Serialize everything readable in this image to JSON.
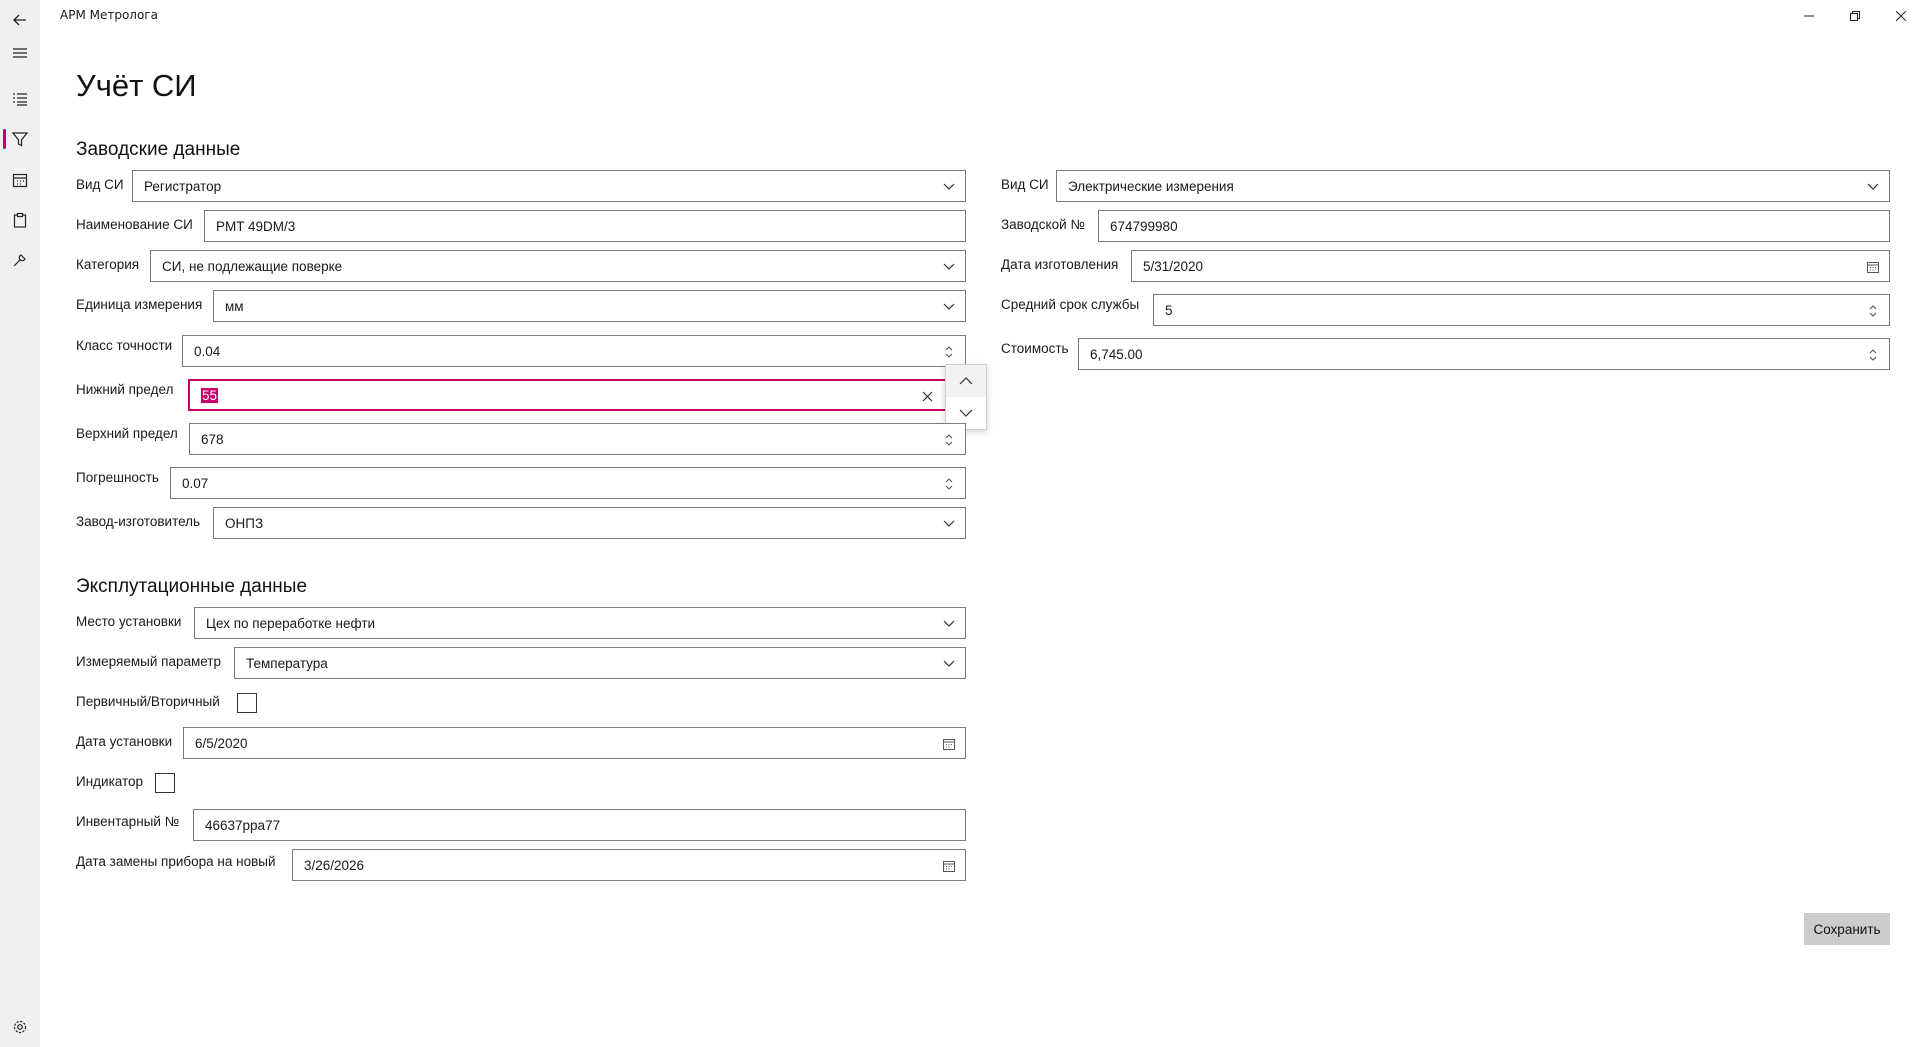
{
  "app": {
    "title": "АРМ Метролога"
  },
  "page": {
    "title": "Учёт СИ"
  },
  "sections": {
    "factory": "Заводские данные",
    "operation": "Эксплутационные данные"
  },
  "factory_left": {
    "vid_si": {
      "label": "Вид СИ",
      "value": "Регистратор"
    },
    "naimenovanie": {
      "label": "Наименование СИ",
      "value": "PMT 49DM/3"
    },
    "kategoriya": {
      "label": "Категория",
      "value": "СИ, не подлежащие поверке"
    },
    "edinica": {
      "label": "Единица измерения",
      "value": "мм"
    },
    "klass": {
      "label": "Класс точности",
      "value": "0.04"
    },
    "nizhniy": {
      "label": "Нижний предел",
      "value": "55"
    },
    "verhniy": {
      "label": "Верхний предел",
      "value": "678"
    },
    "pogreshnost": {
      "label": "Погрешность",
      "value": "0.07"
    },
    "zavod": {
      "label": "Завод-изготовитель",
      "value": "ОНПЗ"
    }
  },
  "factory_right": {
    "vid_si": {
      "label": "Вид СИ",
      "value": "Электрические измерения"
    },
    "zav_nomer": {
      "label": "Заводской №",
      "value": "674799980"
    },
    "data_izg": {
      "label": "Дата изготовления",
      "value": "5/31/2020"
    },
    "srok": {
      "label": "Средний срок службы",
      "value": "5"
    },
    "stoimost": {
      "label": "Стоимость",
      "value": "6,745.00"
    }
  },
  "operation": {
    "mesto": {
      "label": "Место установки",
      "value": "Цех по переработке нефти"
    },
    "parametr": {
      "label": "Измеряемый параметр",
      "value": "Температура"
    },
    "perv_vtor": {
      "label": "Первичный/Вторичный",
      "checked": false
    },
    "data_ust": {
      "label": "Дата установки",
      "value": "6/5/2020"
    },
    "indikator": {
      "label": "Индикатор",
      "checked": false
    },
    "inv_nomer": {
      "label": "Инвентарный №",
      "value": "46637ppa77"
    },
    "data_zameny": {
      "label": "Дата замены прибора на новый",
      "value": "3/26/2026"
    }
  },
  "actions": {
    "save": "Сохранить"
  },
  "colors": {
    "accent": "#c5006b",
    "rail": "#f0f0f0",
    "button": "#cccccc"
  },
  "icons": [
    "back-icon",
    "hamburger-icon",
    "list-icon",
    "filter-icon",
    "calendar-icon",
    "clipboard-icon",
    "wrench-icon",
    "settings-icon",
    "minimize-icon",
    "restore-icon",
    "close-icon",
    "chevron-down-icon",
    "spin-icon",
    "calendar-icon",
    "clear-icon",
    "chevron-up-icon"
  ]
}
